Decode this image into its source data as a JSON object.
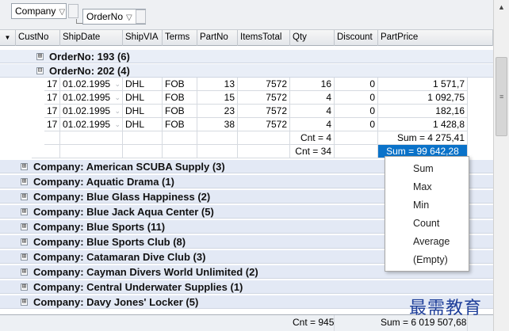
{
  "group_panel": {
    "chips": [
      {
        "label": "Company",
        "filter_icon": "filter-icon"
      },
      {
        "label": "OrderNo",
        "filter_icon": "filter-icon"
      }
    ]
  },
  "header": {
    "indicator": "▼",
    "columns": [
      "CustNo",
      "ShipDate",
      "ShipVIA",
      "Terms",
      "PartNo",
      "ItemsTotal",
      "Qty",
      "Discount",
      "PartPrice"
    ]
  },
  "groups_order": [
    {
      "label": "OrderNo: 193 (6)",
      "expander": "⊞"
    },
    {
      "label": "OrderNo: 202 (4)",
      "expander": "⊟"
    }
  ],
  "rows": [
    {
      "custno": "17",
      "shipdate": "01.02.1995",
      "shipvia": "DHL",
      "terms": "FOB",
      "partno": "13",
      "itemstotal": "7572",
      "qty": "16",
      "discount": "0",
      "partprice": "1 571,7"
    },
    {
      "custno": "17",
      "shipdate": "01.02.1995",
      "shipvia": "DHL",
      "terms": "FOB",
      "partno": "15",
      "itemstotal": "7572",
      "qty": "4",
      "discount": "0",
      "partprice": "1 092,75"
    },
    {
      "custno": "17",
      "shipdate": "01.02.1995",
      "shipvia": "DHL",
      "terms": "FOB",
      "partno": "23",
      "itemstotal": "7572",
      "qty": "4",
      "discount": "0",
      "partprice": "182,16"
    },
    {
      "custno": "17",
      "shipdate": "01.02.1995",
      "shipvia": "DHL",
      "terms": "FOB",
      "partno": "38",
      "itemstotal": "7572",
      "qty": "4",
      "discount": "0",
      "partprice": "1 428,8"
    }
  ],
  "summary_order": {
    "qty": "Cnt = 4",
    "partprice": "Sum = 4 275,41"
  },
  "summary_company": {
    "qty": "Cnt = 34",
    "partprice": "Sum = 99 642,28"
  },
  "company_groups": [
    "Company: American SCUBA Supply (3)",
    "Company: Aquatic Drama (1)",
    "Company: Blue Glass Happiness (2)",
    "Company: Blue Jack Aqua Center (5)",
    "Company: Blue Sports (11)",
    "Company: Blue Sports Club (8)",
    "Company: Catamaran Dive Club (3)",
    "Company: Cayman Divers World Unlimited (2)",
    "Company: Central Underwater Supplies (1)",
    "Company: Davy Jones' Locker (5)"
  ],
  "company_expander": "⊞",
  "footer": {
    "qty": "Cnt = 945",
    "partprice": "Sum = 6 019 507,68"
  },
  "menu": {
    "items": [
      "Sum",
      "Max",
      "Min",
      "Count",
      "Average",
      "(Empty)"
    ]
  },
  "scrollbar": {
    "up_arrow": "▲",
    "grip": "≡"
  },
  "watermark": "最需教育",
  "colors": {
    "selection": "#0a72c9",
    "group_row": "#e3e9f5"
  }
}
